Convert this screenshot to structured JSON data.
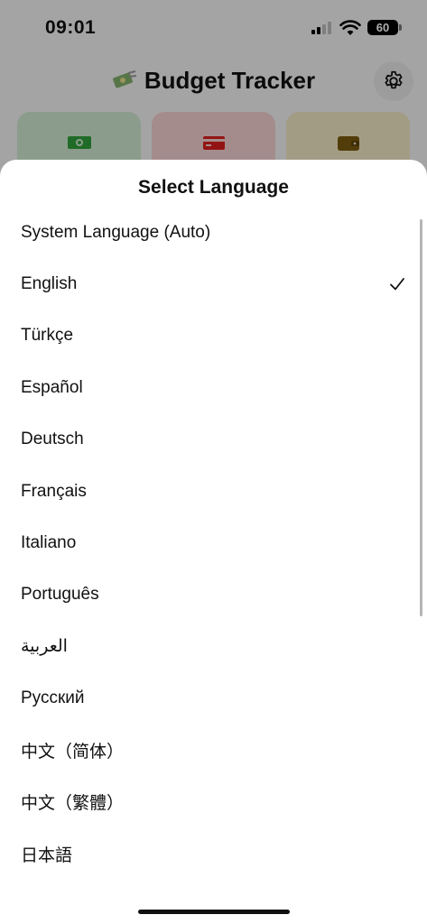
{
  "status_bar": {
    "time": "09:01",
    "battery": "60"
  },
  "app": {
    "title": "Budget Tracker",
    "logo_icon": "money-bag-icon",
    "settings_icon": "gear-icon"
  },
  "cards": [
    {
      "name": "income",
      "icon": "banknote-icon",
      "color": "#2e9e3a"
    },
    {
      "name": "expense",
      "icon": "credit-card-icon",
      "color": "#d91e1e"
    },
    {
      "name": "balance",
      "icon": "wallet-icon",
      "color": "#7a5a10"
    }
  ],
  "sheet": {
    "title": "Select Language",
    "items": [
      {
        "label": "System Language (Auto)",
        "selected": false
      },
      {
        "label": "English",
        "selected": true
      },
      {
        "label": "Türkçe",
        "selected": false
      },
      {
        "label": "Español",
        "selected": false
      },
      {
        "label": "Deutsch",
        "selected": false
      },
      {
        "label": "Français",
        "selected": false
      },
      {
        "label": "Italiano",
        "selected": false
      },
      {
        "label": "Português",
        "selected": false
      },
      {
        "label": "العربية",
        "selected": false
      },
      {
        "label": "Русский",
        "selected": false
      },
      {
        "label": "中文（简体）",
        "selected": false
      },
      {
        "label": "中文（繁體）",
        "selected": false
      },
      {
        "label": "日本語",
        "selected": false
      }
    ]
  }
}
